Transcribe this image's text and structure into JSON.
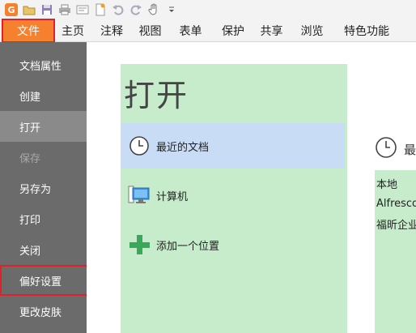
{
  "quick_access": [
    {
      "icon": "app-logo-icon"
    },
    {
      "icon": "open-folder-icon"
    },
    {
      "icon": "save-icon"
    },
    {
      "icon": "print-icon"
    },
    {
      "icon": "print-preview-icon"
    },
    {
      "icon": "new-document-icon"
    },
    {
      "icon": "undo-icon"
    },
    {
      "icon": "redo-icon"
    },
    {
      "icon": "hand-tool-icon"
    },
    {
      "icon": "dropdown-icon"
    }
  ],
  "tabs": [
    {
      "label": "文件"
    },
    {
      "label": "主页"
    },
    {
      "label": "注释"
    },
    {
      "label": "视图"
    },
    {
      "label": "表单"
    },
    {
      "label": "保护"
    },
    {
      "label": "共享"
    },
    {
      "label": "浏览"
    },
    {
      "label": "特色功能"
    }
  ],
  "nav": [
    {
      "label": "文档属性"
    },
    {
      "label": "创建"
    },
    {
      "label": "打开"
    },
    {
      "label": "保存"
    },
    {
      "label": "另存为"
    },
    {
      "label": "打印"
    },
    {
      "label": "关闭"
    },
    {
      "label": "偏好设置"
    },
    {
      "label": "更改皮肤"
    }
  ],
  "open_panel": {
    "title": "打开",
    "places": [
      {
        "label": "最近的文档",
        "icon": "clock-icon"
      },
      {
        "label": "计算机",
        "icon": "computer-icon"
      },
      {
        "label": "添加一个位置",
        "icon": "plus-icon"
      }
    ]
  },
  "recent": {
    "heading": "最",
    "items": [
      {
        "label": "本地"
      },
      {
        "label": "Alfresco"
      },
      {
        "label": "福昕企业"
      }
    ]
  },
  "colors": {
    "file_tab": "#f5802d",
    "nav_bg": "#6b6b6b",
    "panel_bg": "#c6eccc",
    "selected_place": "#c8dcf5",
    "highlight_border": "#e2202a"
  }
}
